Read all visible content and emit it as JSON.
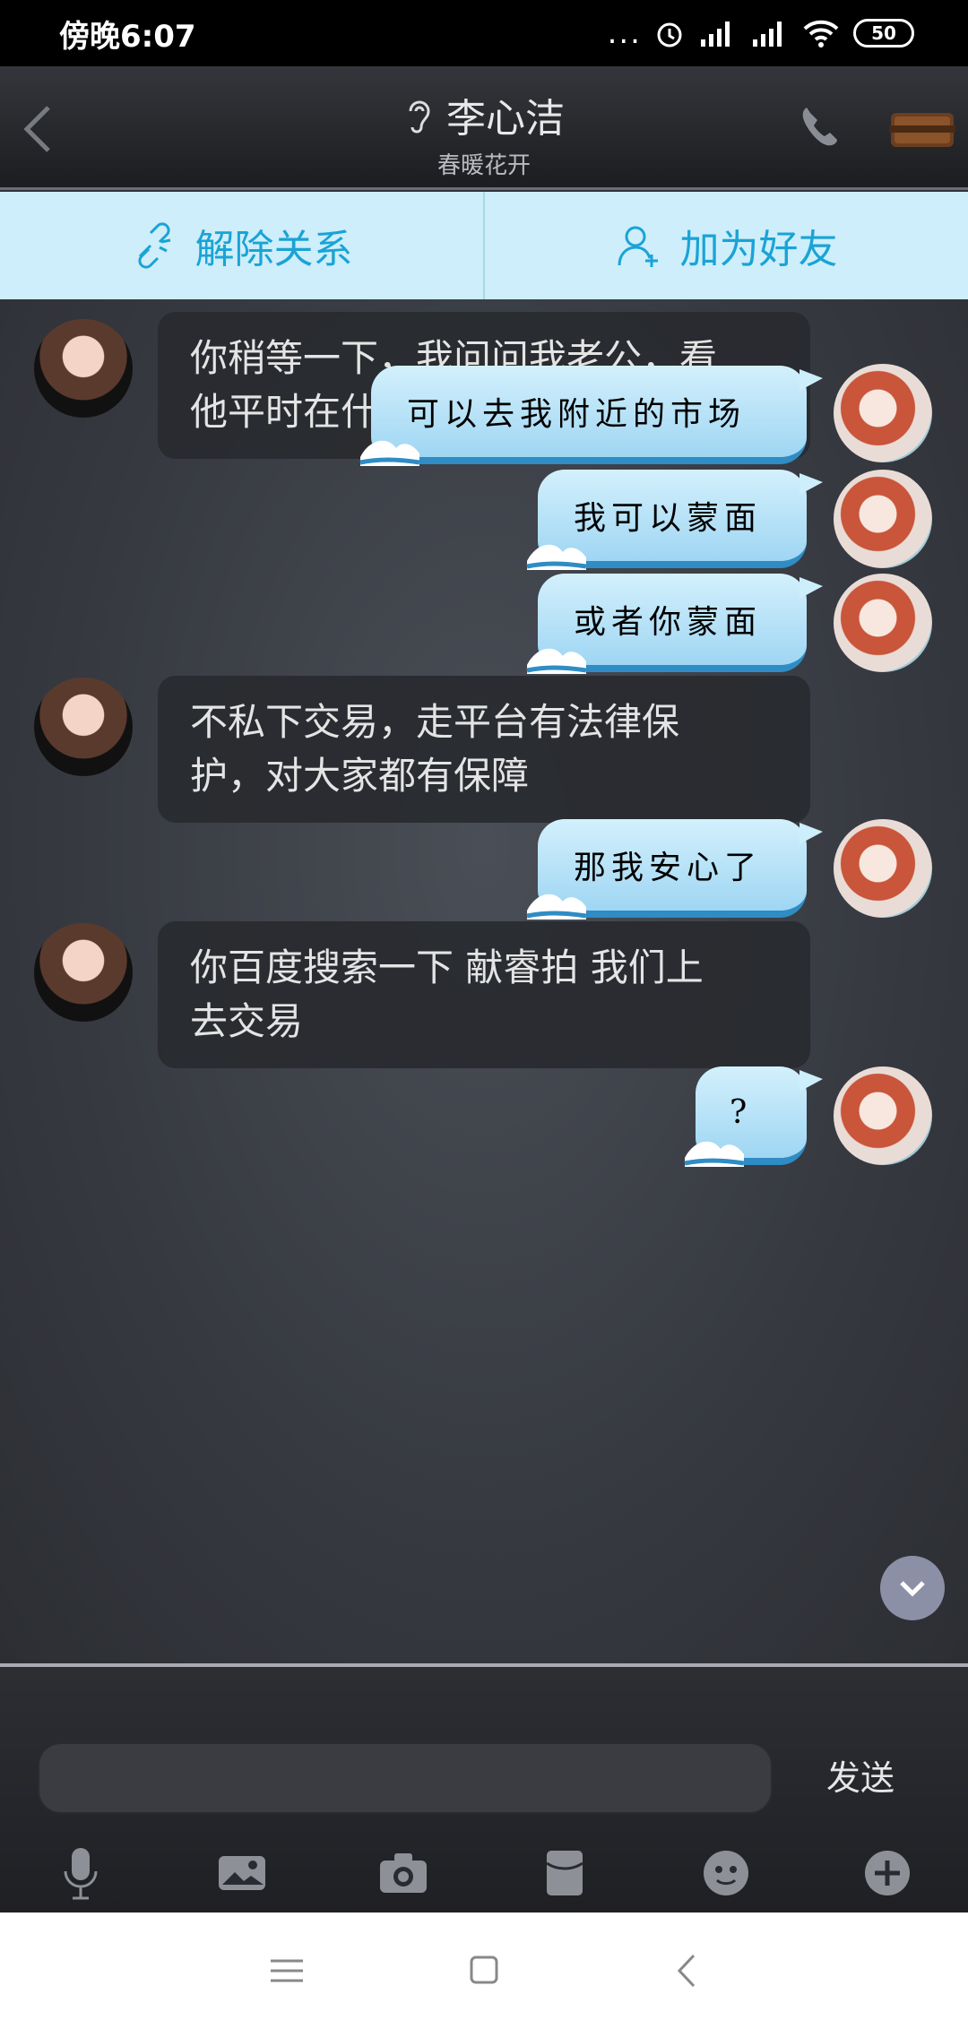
{
  "status_bar": {
    "time": "傍晚6:07",
    "dots": "...",
    "battery": "50"
  },
  "header": {
    "title": "李心洁",
    "subtitle": "春暖花开"
  },
  "actions": {
    "unbind_label": "解除关系",
    "add_friend_label": "加为好友"
  },
  "messages": [
    {
      "side": "left",
      "text_line1": "你稍等一下，我问问我老公，看",
      "text_line2": "他平时在什么地方交易的"
    },
    {
      "side": "right",
      "text": "可以去我附近的市场"
    },
    {
      "side": "right",
      "text": "我可以蒙面"
    },
    {
      "side": "right",
      "text": "或者你蒙面"
    },
    {
      "side": "left",
      "text_line1": "不私下交易，走平台有法律保",
      "text_line2": "护，对大家都有保障"
    },
    {
      "side": "right",
      "text": "那我安心了"
    },
    {
      "side": "left",
      "text_line1": "你百度搜索一下 献睿拍 我们上",
      "text_line2": "去交易"
    },
    {
      "side": "right",
      "text": "?"
    }
  ],
  "composer": {
    "input_value": "",
    "send_label": "发送"
  },
  "toolbar_icons": [
    "microphone-icon",
    "image-gallery-icon",
    "camera-icon",
    "red-packet-icon",
    "emoji-icon",
    "plus-icon"
  ],
  "colors": {
    "action_bar_bg": "#cdeefa",
    "action_text": "#1aa3d6",
    "bubble_right_top": "#d3f0fc",
    "bubble_right_bottom": "#9fd6f3"
  }
}
